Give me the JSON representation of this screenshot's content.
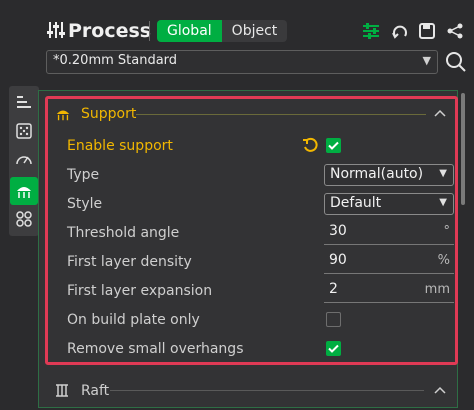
{
  "header": {
    "title": "Process",
    "toggle": {
      "global": "Global",
      "object": "Object",
      "selected": "Global"
    },
    "icons": [
      "sliders-icon",
      "compare-icon",
      "save-icon",
      "connections-icon"
    ]
  },
  "preset": {
    "value": "*0.20mm Standard"
  },
  "sidebar": {
    "tabs": [
      "quality-tab",
      "strength-tab",
      "speed-tab",
      "support-tab",
      "others-tab"
    ],
    "active": "support-tab"
  },
  "colors": {
    "accent": "#00ae42",
    "highlight": "#e03a55",
    "label_active": "#f2b700"
  },
  "support": {
    "title": "Support",
    "enable_support": {
      "label": "Enable support",
      "checked": true
    },
    "type": {
      "label": "Type",
      "value": "Normal(auto)"
    },
    "style": {
      "label": "Style",
      "value": "Default"
    },
    "threshold_angle": {
      "label": "Threshold angle",
      "value": "30",
      "unit": "°"
    },
    "first_layer_density": {
      "label": "First layer density",
      "value": "90",
      "unit": "%"
    },
    "first_layer_expansion": {
      "label": "First layer expansion",
      "value": "2",
      "unit": "mm"
    },
    "on_build_plate_only": {
      "label": "On build plate only",
      "checked": false
    },
    "remove_small_overhangs": {
      "label": "Remove small overhangs",
      "checked": true
    }
  },
  "raft": {
    "title": "Raft"
  }
}
